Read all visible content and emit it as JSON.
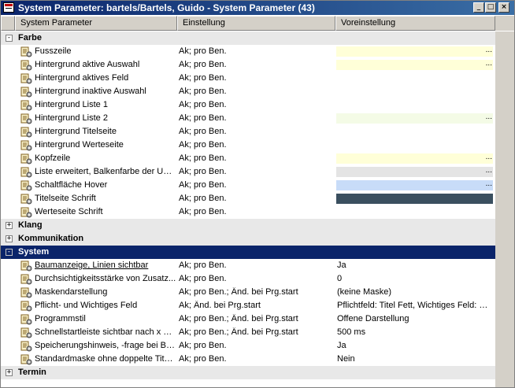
{
  "window": {
    "title": "System Parameter: bartels/Bartels, Guido - System Parameter (43)"
  },
  "titlebar_buttons": {
    "minimize": "_",
    "maximize": "□",
    "close": "×"
  },
  "columns": [
    "System Parameter",
    "Einstellung",
    "Voreinstellung"
  ],
  "colors": {
    "selection": "#0a246a",
    "group_bg": "#e8e8e8"
  },
  "groups": [
    {
      "name": "Farbe",
      "toggle": "-",
      "selected": false,
      "items": [
        {
          "label": "Fusszeile",
          "value": "Ak; pro Ben.",
          "default": "",
          "swatch": "#ffffd8",
          "dots": "..."
        },
        {
          "label": "Hintergrund aktive Auswahl",
          "value": "Ak; pro Ben.",
          "default": "",
          "swatch": "#ffffd8",
          "dots": "..."
        },
        {
          "label": "Hintergrund aktives Feld",
          "value": "Ak; pro Ben.",
          "default": "",
          "swatch": "",
          "dots": ""
        },
        {
          "label": "Hintergrund inaktive Auswahl",
          "value": "Ak; pro Ben.",
          "default": "",
          "swatch": "",
          "dots": ""
        },
        {
          "label": "Hintergrund Liste 1",
          "value": "Ak; pro Ben.",
          "default": "",
          "swatch": "",
          "dots": ""
        },
        {
          "label": "Hintergrund Liste 2",
          "value": "Ak; pro Ben.",
          "default": "",
          "swatch": "#f4fbe6",
          "dots": "..."
        },
        {
          "label": "Hintergrund Titelseite",
          "value": "Ak; pro Ben.",
          "default": "",
          "swatch": "",
          "dots": ""
        },
        {
          "label": "Hintergrund Werteseite",
          "value": "Ak; pro Ben.",
          "default": "",
          "swatch": "",
          "dots": ""
        },
        {
          "label": "Kopfzeile",
          "value": "Ak; pro Ben.",
          "default": "",
          "swatch": "#ffffd8",
          "dots": "..."
        },
        {
          "label": "Liste erweitert, Balkenfarbe der Unte...",
          "value": "Ak; pro Ben.",
          "default": "",
          "swatch": "#e4e4e4",
          "dots": "..."
        },
        {
          "label": "Schaltfläche Hover",
          "value": "Ak; pro Ben.",
          "default": "",
          "swatch": "#c8dcf8",
          "dots": "..."
        },
        {
          "label": "Titelseite Schrift",
          "value": "Ak; pro Ben.",
          "default": "",
          "swatch": "#3a4f5f",
          "dots": ""
        },
        {
          "label": "Werteseite Schrift",
          "value": "Ak; pro Ben.",
          "default": "",
          "swatch": "",
          "dots": ""
        }
      ]
    },
    {
      "name": "Klang",
      "toggle": "+",
      "selected": false,
      "items": []
    },
    {
      "name": "Kommunikation",
      "toggle": "+",
      "selected": false,
      "items": []
    },
    {
      "name": "System",
      "toggle": "-",
      "selected": true,
      "items": [
        {
          "label": "Baumanzeige, Linien sichtbar",
          "value": "Ak; pro Ben.",
          "default": "Ja",
          "swatch": "",
          "dots": "",
          "underline": true
        },
        {
          "label": "Durchsichtigkeitsstärke von Zusatz...",
          "value": "Ak; pro Ben.",
          "default": "0",
          "swatch": "",
          "dots": ""
        },
        {
          "label": "Maskendarstellung",
          "value": "Ak; pro Ben.; Änd. bei Prg.start",
          "default": "(keine Maske)",
          "swatch": "",
          "dots": ""
        },
        {
          "label": "Pflicht- und Wichtiges Feld",
          "value": "Ak; Änd. bei Prg.start",
          "default": "Pflichtfeld: Titel Fett, Wichtiges Feld: St...",
          "swatch": "",
          "dots": ""
        },
        {
          "label": "Programmstil",
          "value": "Ak; pro Ben.; Änd. bei Prg.start",
          "default": "Offene Darstellung",
          "swatch": "",
          "dots": ""
        },
        {
          "label": "Schnellstartleiste sichtbar nach x Mill...",
          "value": "Ak; pro Ben.; Änd. bei Prg.start",
          "default": "500 ms",
          "swatch": "",
          "dots": ""
        },
        {
          "label": "Speicherungshinweis, -frage bei Bea...",
          "value": "Ak; pro Ben.",
          "default": "Ja",
          "swatch": "",
          "dots": ""
        },
        {
          "label": "Standardmaske ohne doppelte Titell...",
          "value": "Ak; pro Ben.",
          "default": "Nein",
          "swatch": "",
          "dots": ""
        }
      ]
    },
    {
      "name": "Termin",
      "toggle": "+",
      "selected": false,
      "items": []
    }
  ]
}
